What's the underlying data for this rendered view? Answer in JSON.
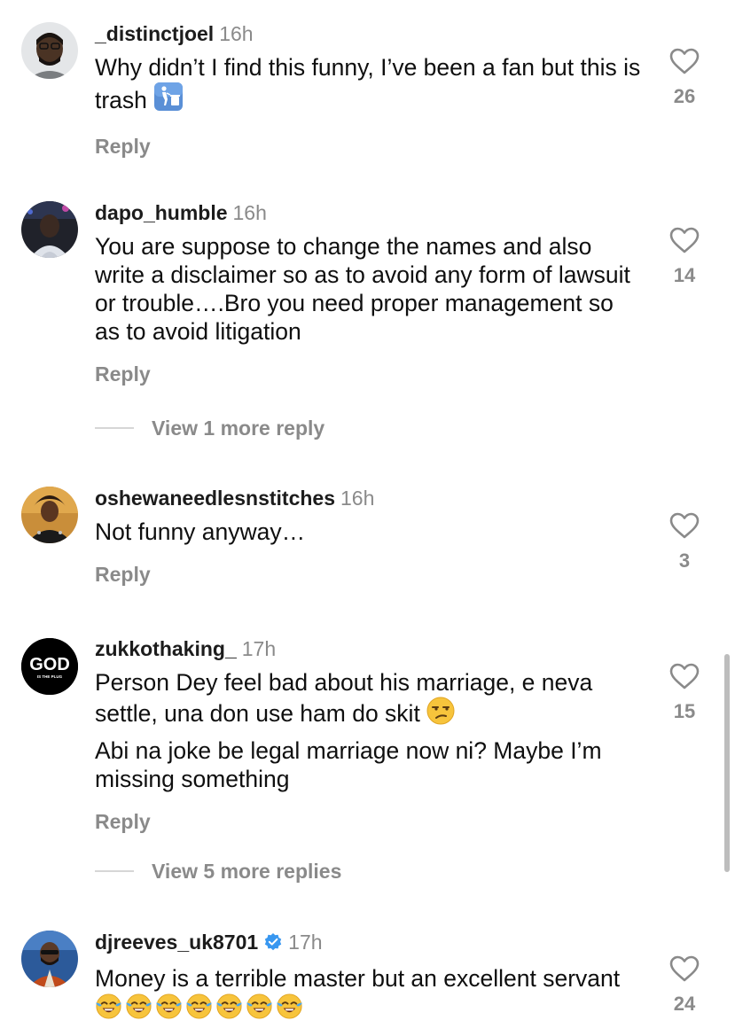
{
  "comments": [
    {
      "username": "_distinctjoel",
      "time": "16h",
      "text": "Why didn’t I find this funny, I’ve been a fan but this is trash",
      "emoji": "put-litter-in-bin",
      "reply_label": "Reply",
      "likes": "26"
    },
    {
      "username": "dapo_humble",
      "time": "16h",
      "text": "You are suppose to change the names and also write a disclaimer so as to avoid any form of lawsuit or trouble….Bro you need proper management so as to avoid litigation",
      "reply_label": "Reply",
      "likes": "14",
      "view_more": "View 1 more reply"
    },
    {
      "username": "oshewaneedlesnstitches",
      "time": "16h",
      "text": "Not funny anyway…",
      "reply_label": "Reply",
      "likes": "3"
    },
    {
      "username": "zukkothaking_",
      "time": "17h",
      "avatar_text": "GOD",
      "avatar_subtext": "IS THE PLUG",
      "text": "Person Dey feel bad about his marriage, e neva settle, una don use ham do skit",
      "emoji": "unamused-face",
      "text2": "Abi na joke be legal marriage now ni? Maybe I’m missing something",
      "reply_label": "Reply",
      "likes": "15",
      "view_more": "View 5 more replies"
    },
    {
      "username": "djreeves_uk8701",
      "time": "17h",
      "verified": true,
      "text": "Money is a terrible master but an excellent servant",
      "emoji": "face-with-tears-of-joy",
      "emoji_count": 7,
      "likes": "24"
    }
  ],
  "colors": {
    "username": "#1c1c1c",
    "muted": "#8a8a8a",
    "verified": "#3897f0"
  }
}
